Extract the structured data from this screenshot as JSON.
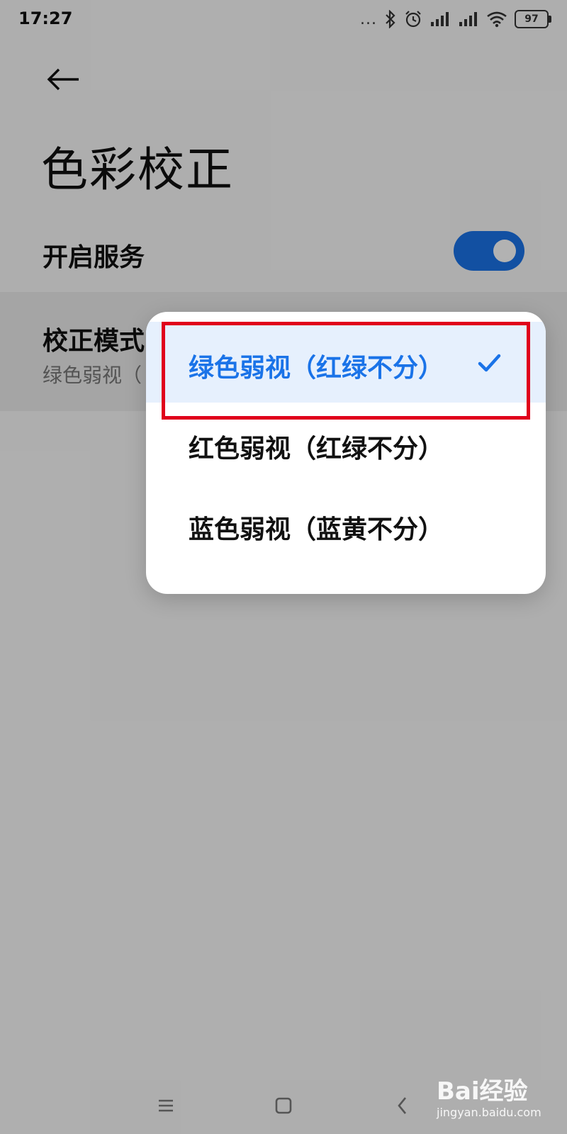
{
  "status_bar": {
    "time": "17:27",
    "dots": "...",
    "battery": "97"
  },
  "header": {
    "title": "色彩校正"
  },
  "service_row": {
    "label": "开启服务",
    "toggle_on": true
  },
  "mode_row": {
    "label": "校正模式",
    "sub": "绿色弱视（"
  },
  "menu": {
    "items": [
      {
        "label": "绿色弱视（红绿不分）",
        "selected": true
      },
      {
        "label": "红色弱视（红绿不分）",
        "selected": false
      },
      {
        "label": "蓝色弱视（蓝黄不分）",
        "selected": false
      }
    ]
  },
  "watermark": {
    "big": "Bai经验",
    "small": "jingyan.baidu.com"
  },
  "colors": {
    "accent": "#1a73e8",
    "highlight_border": "#e0001b"
  },
  "icons": {
    "back": "arrow-left-icon",
    "check": "check-icon",
    "bluetooth": "bluetooth-icon",
    "alarm": "alarm-icon",
    "signal": "signal-icon",
    "wifi": "wifi-icon",
    "battery": "battery-icon",
    "menu": "menu-icon",
    "home": "home-icon",
    "nav_back": "nav-back-icon"
  }
}
